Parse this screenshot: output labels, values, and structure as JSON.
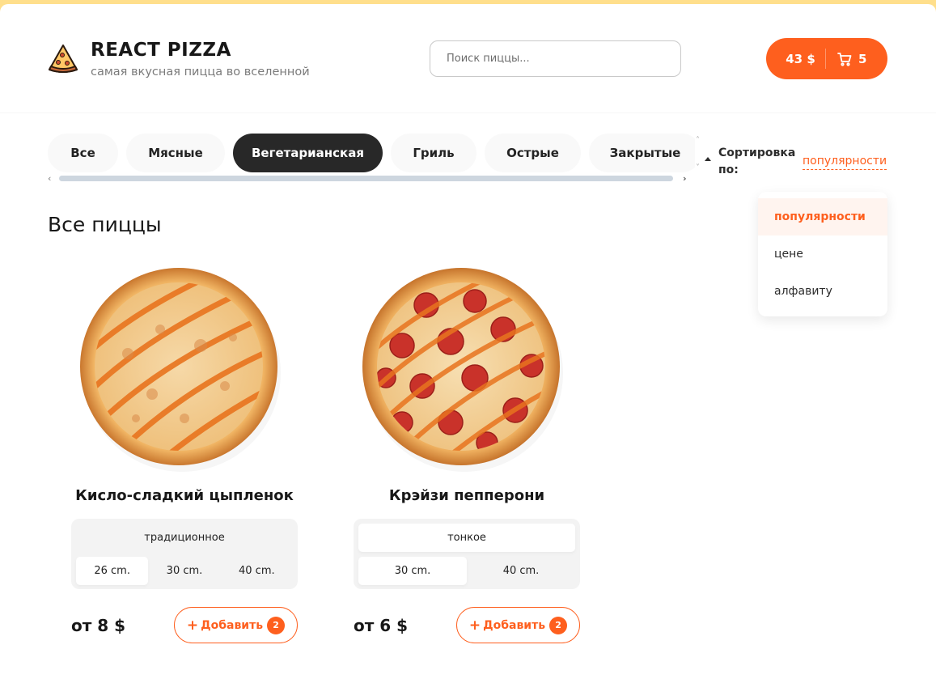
{
  "header": {
    "logo_title": "REACT PIZZA",
    "logo_subtitle": "самая вкусная пицца во вселенной",
    "search_placeholder": "Поиск пиццы...",
    "cart_total": "43 $",
    "cart_count": "5"
  },
  "categories": {
    "items": [
      {
        "label": "Все"
      },
      {
        "label": "Мясные"
      },
      {
        "label": "Вегетарианская"
      },
      {
        "label": "Гриль"
      },
      {
        "label": "Острые"
      },
      {
        "label": "Закрытые"
      }
    ],
    "active": "Вегетарианская"
  },
  "sort": {
    "label": "Сортировка по:",
    "selected": "популярности",
    "options": [
      {
        "label": "популярности"
      },
      {
        "label": "цене"
      },
      {
        "label": "алфавиту"
      }
    ]
  },
  "page_title": "Все пиццы",
  "pizzas": [
    {
      "name": "Кисло-сладкий цыпленок",
      "types": [
        "традиционное"
      ],
      "active_type": "традиционное",
      "sizes": [
        "26 cm.",
        "30 cm.",
        "40 cm."
      ],
      "active_size": "26 cm.",
      "price": "от 8 $",
      "add_label": "Добавить",
      "add_count": "2"
    },
    {
      "name": "Крэйзи пепперони",
      "types": [
        "тонкое"
      ],
      "active_type": "тонкое",
      "sizes": [
        "30 cm.",
        "40 cm."
      ],
      "active_size": "30 cm.",
      "price": "от 6 $",
      "add_label": "Добавить",
      "add_count": "2"
    }
  ],
  "colors": {
    "accent": "#fe5f1e",
    "background": "#ffdf8c",
    "active_category": "#282828"
  },
  "icons": [
    "pizza-logo-icon",
    "cart-icon",
    "sort-arrow-icon",
    "plus-icon"
  ]
}
